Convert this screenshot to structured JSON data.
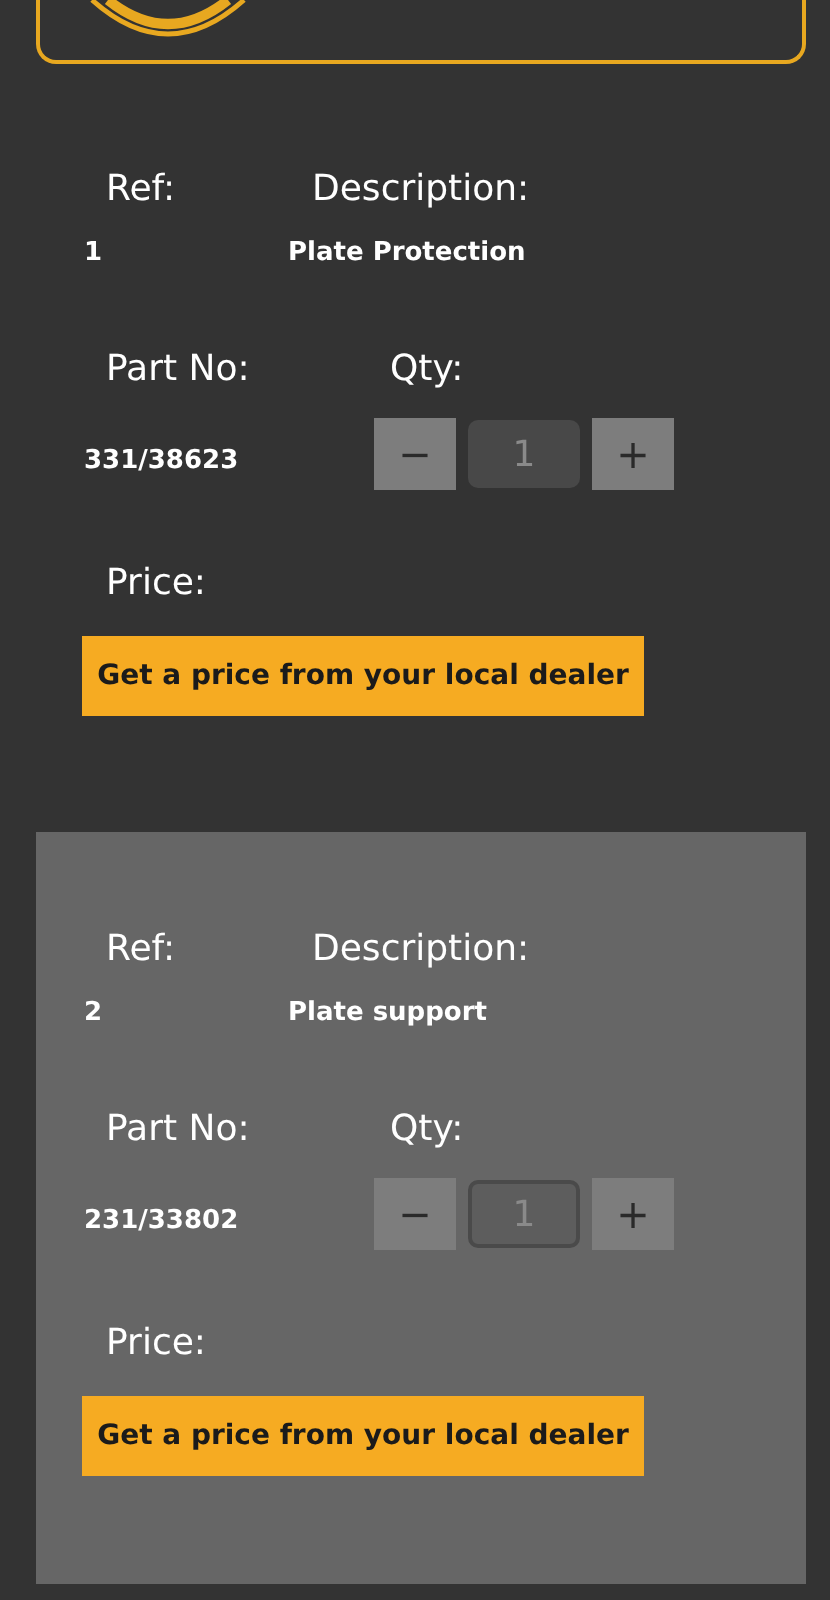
{
  "parts": [
    {
      "ref_label": "Ref:",
      "ref": "1",
      "description_label": "Description:",
      "description": "Plate Protection",
      "part_no_label": "Part No:",
      "part_no": "331/38623",
      "qty_label": "Qty:",
      "minus": "−",
      "qty": "1",
      "plus": "+",
      "price_label": "Price:",
      "button": "Get a price from your local dealer",
      "highlighted": false
    },
    {
      "ref_label": "Ref:",
      "ref": "2",
      "description_label": "Description:",
      "description": "Plate support",
      "part_no_label": "Part No:",
      "part_no": "231/33802",
      "qty_label": "Qty:",
      "minus": "−",
      "qty": "1",
      "plus": "+",
      "price_label": "Price:",
      "button": "Get a price from your local dealer",
      "highlighted": true
    }
  ]
}
